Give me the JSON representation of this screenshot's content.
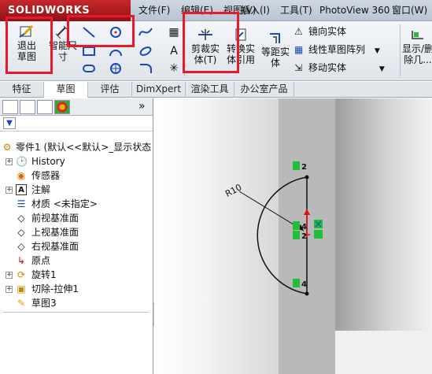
{
  "app": {
    "logo": "SOLIDWORKS",
    "menu": [
      {
        "label": "文件(F)"
      },
      {
        "label": "编辑(E)"
      },
      {
        "label": "视图(V)"
      },
      {
        "label": "插入(I)"
      },
      {
        "label": "工具(T)"
      },
      {
        "label": "PhotoView 360"
      },
      {
        "label": "窗口(W)"
      }
    ]
  },
  "toolbar": {
    "exit_sketch": "退出草图",
    "smart_dim_1": "智能尺",
    "smart_dim_2": "寸",
    "trim_1": "剪裁实",
    "trim_2": "体(T)",
    "convert_1": "转换实",
    "convert_2": "体引用",
    "offset_1": "等距实",
    "offset_2": "体",
    "mirror": "镜向实体",
    "linear_pattern": "线性草图阵列",
    "move": "移动实体",
    "display_1": "显示/删",
    "display_2": "除几..."
  },
  "tabs": [
    {
      "label": "特征"
    },
    {
      "label": "草图"
    },
    {
      "label": "评估"
    },
    {
      "label": "DimXpert"
    },
    {
      "label": "渲染工具"
    },
    {
      "label": "办公室产品"
    }
  ],
  "tree": {
    "root": "零件1 (默认<<默认>_显示状态",
    "items": [
      {
        "label": "History"
      },
      {
        "label": "传感器"
      },
      {
        "label": "注解"
      },
      {
        "label": "材质 <未指定>"
      },
      {
        "label": "前视基准面"
      },
      {
        "label": "上视基准面"
      },
      {
        "label": "右视基准面"
      },
      {
        "label": "原点"
      },
      {
        "label": "旋转1"
      },
      {
        "label": "切除-拉伸1"
      },
      {
        "label": "草图3"
      }
    ]
  },
  "sketch": {
    "radius_label": "R10",
    "relation_labels": [
      "2",
      "4",
      "2",
      "4"
    ]
  },
  "colors": {
    "highlight": "#e8192c",
    "relation_green": "#1fbf3a"
  }
}
